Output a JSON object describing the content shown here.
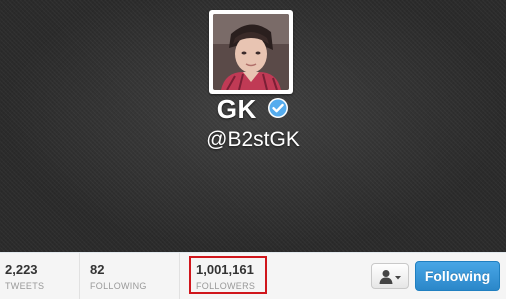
{
  "profile": {
    "name": "GK",
    "handle": "@B2stGK",
    "verified": true
  },
  "stats": {
    "tweets": {
      "count": "2,223",
      "label": "TWEETS"
    },
    "following": {
      "count": "82",
      "label": "FOLLOWING"
    },
    "followers": {
      "count": "1,001,161",
      "label": "FOLLOWERS"
    }
  },
  "actions": {
    "user_menu_icon": "person-icon",
    "follow_label": "Following"
  },
  "colors": {
    "follow_button": "#3b94d9",
    "verified_badge": "#55acee",
    "highlight_box": "#d0161c"
  }
}
